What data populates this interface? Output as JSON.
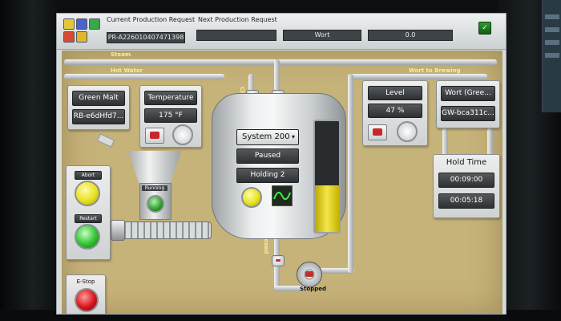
{
  "toolbar": {
    "current_request_label": "Current Production Request",
    "current_request_value": "PR-A226010407471398",
    "next_request_label": "Next Production Request",
    "next_request_product": "Wort",
    "next_request_qty": "0.0"
  },
  "pipes": {
    "steam_label": "Steam",
    "hot_water_label": "Hot Water",
    "wort_to_brewing_label": "Wort to Brewing",
    "valve_state_left": "Closed",
    "valve_state_right": "Closed",
    "valve_state_bottom": "Closed"
  },
  "material": {
    "name": "Green Malt",
    "lot": "RB-e6dHfd7..."
  },
  "temperature": {
    "label": "Temperature",
    "value": "175 °F"
  },
  "tank": {
    "system_select": "System 200",
    "status": "Paused",
    "step": "Holding 2",
    "level_fraction": 0.42
  },
  "level_panel": {
    "label": "Level",
    "value": "47 %"
  },
  "wort_panel": {
    "product": "Wort (Gree...",
    "lot": "GW-bca311c..."
  },
  "hold_time": {
    "title": "Hold Time",
    "elapsed": "00:09:00",
    "remaining": "00:05:18"
  },
  "hopper": {
    "status_label": "Running"
  },
  "controls": {
    "abort_label": "Abort",
    "restart_label": "Restart",
    "estop_label": "E-Stop"
  },
  "pump": {
    "status_label": "Stopped"
  },
  "colors": {
    "canvas": "#c6b37a",
    "lamp_yellow": "#e8e21c",
    "lamp_green": "#2ec42e",
    "estop_red": "#d8141c",
    "flow_text": "#f3f09a"
  }
}
